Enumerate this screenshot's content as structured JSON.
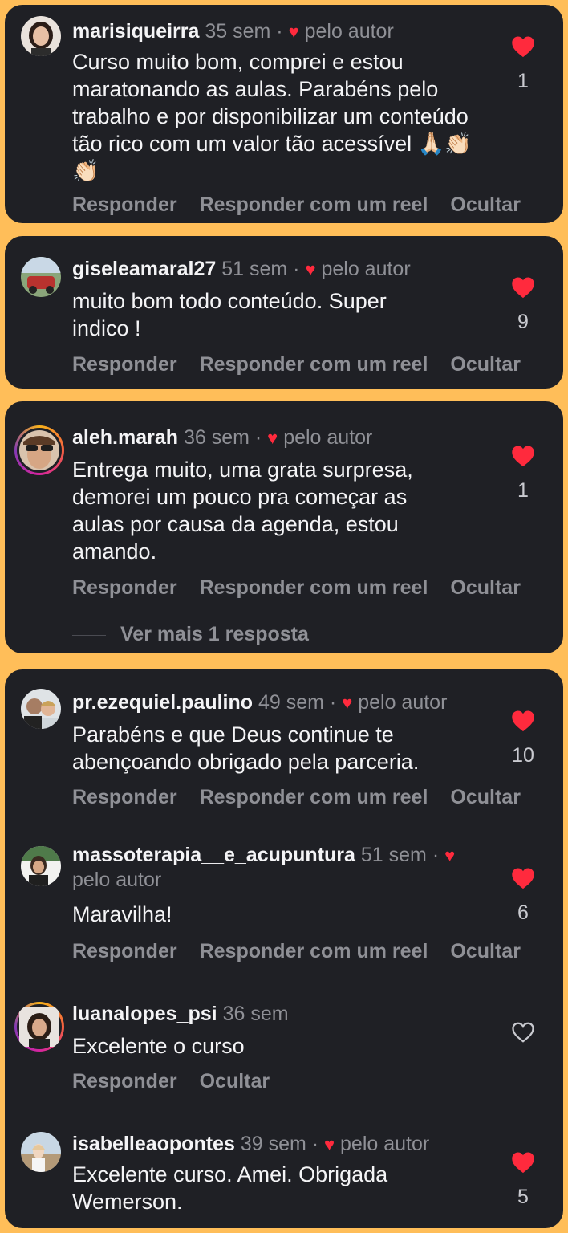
{
  "meta": "pelo autor",
  "actions": {
    "reply": "Responder",
    "reel": "Responder com um reel",
    "hide": "Ocultar"
  },
  "comments": [
    {
      "user": "marisiqueirra",
      "time": "35 sem",
      "text": "Curso muito bom, comprei e estou maratonando as aulas. Parabéns pelo trabalho e por disponibilizar um conteúdo tão rico com um valor tão acessível 🙏🏻👏🏻👏🏻",
      "likes": "1"
    },
    {
      "user": "giseleamaral27",
      "time": "51 sem",
      "text": "muito bom todo conteúdo. Super indico !",
      "likes": "9"
    },
    {
      "user": "aleh.marah",
      "time": "36 sem",
      "text": "Entrega muito, uma grata surpresa, demorei um pouco pra começar as aulas por causa da agenda, estou amando.",
      "likes": "1",
      "more": "Ver mais 1 resposta"
    },
    {
      "user": "pr.ezequiel.paulino",
      "time": "49 sem",
      "text": "Parabéns e que Deus continue te abençoando obrigado pela parceria.",
      "likes": "10"
    },
    {
      "user": "massoterapia__e_acupuntura",
      "time": "51 sem",
      "text": "Maravilha!",
      "likes": "6"
    },
    {
      "user": "luanalopes_psi",
      "time": "36 sem",
      "text": "Excelente o curso"
    },
    {
      "user": "isabelleaopontes",
      "time": "39 sem",
      "text": "Excelente curso. Amei. Obrigada Wemerson.",
      "likes": "5"
    }
  ]
}
